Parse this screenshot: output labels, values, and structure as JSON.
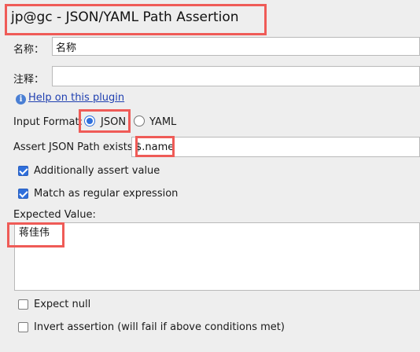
{
  "header": {
    "title": "jp@gc - JSON/YAML Path Assertion"
  },
  "form": {
    "name_label": "名称：",
    "name_value": "名称",
    "comment_label": "注释：",
    "comment_value": "",
    "help_link": "Help on this plugin",
    "help_icon": "info-icon",
    "input_format_label": "Input Format:",
    "format_options": [
      {
        "label": "JSON",
        "selected": true
      },
      {
        "label": "YAML",
        "selected": false
      }
    ],
    "path_label": "Assert JSON Path exists:",
    "path_value": "$.name",
    "additionally_assert_label": "Additionally assert value",
    "additionally_assert_checked": true,
    "regex_label": "Match as regular expression",
    "regex_checked": true,
    "expected_value_label": "Expected Value:",
    "expected_value": "蒋佳伟",
    "expect_null_label": "Expect null",
    "expect_null_checked": false,
    "invert_label": "Invert assertion (will fail if above conditions met)",
    "invert_checked": false
  },
  "colors": {
    "highlight": "#ef5b57",
    "accent": "#2f6fdc",
    "link": "#1f3fb0",
    "background": "#eeeeee"
  }
}
